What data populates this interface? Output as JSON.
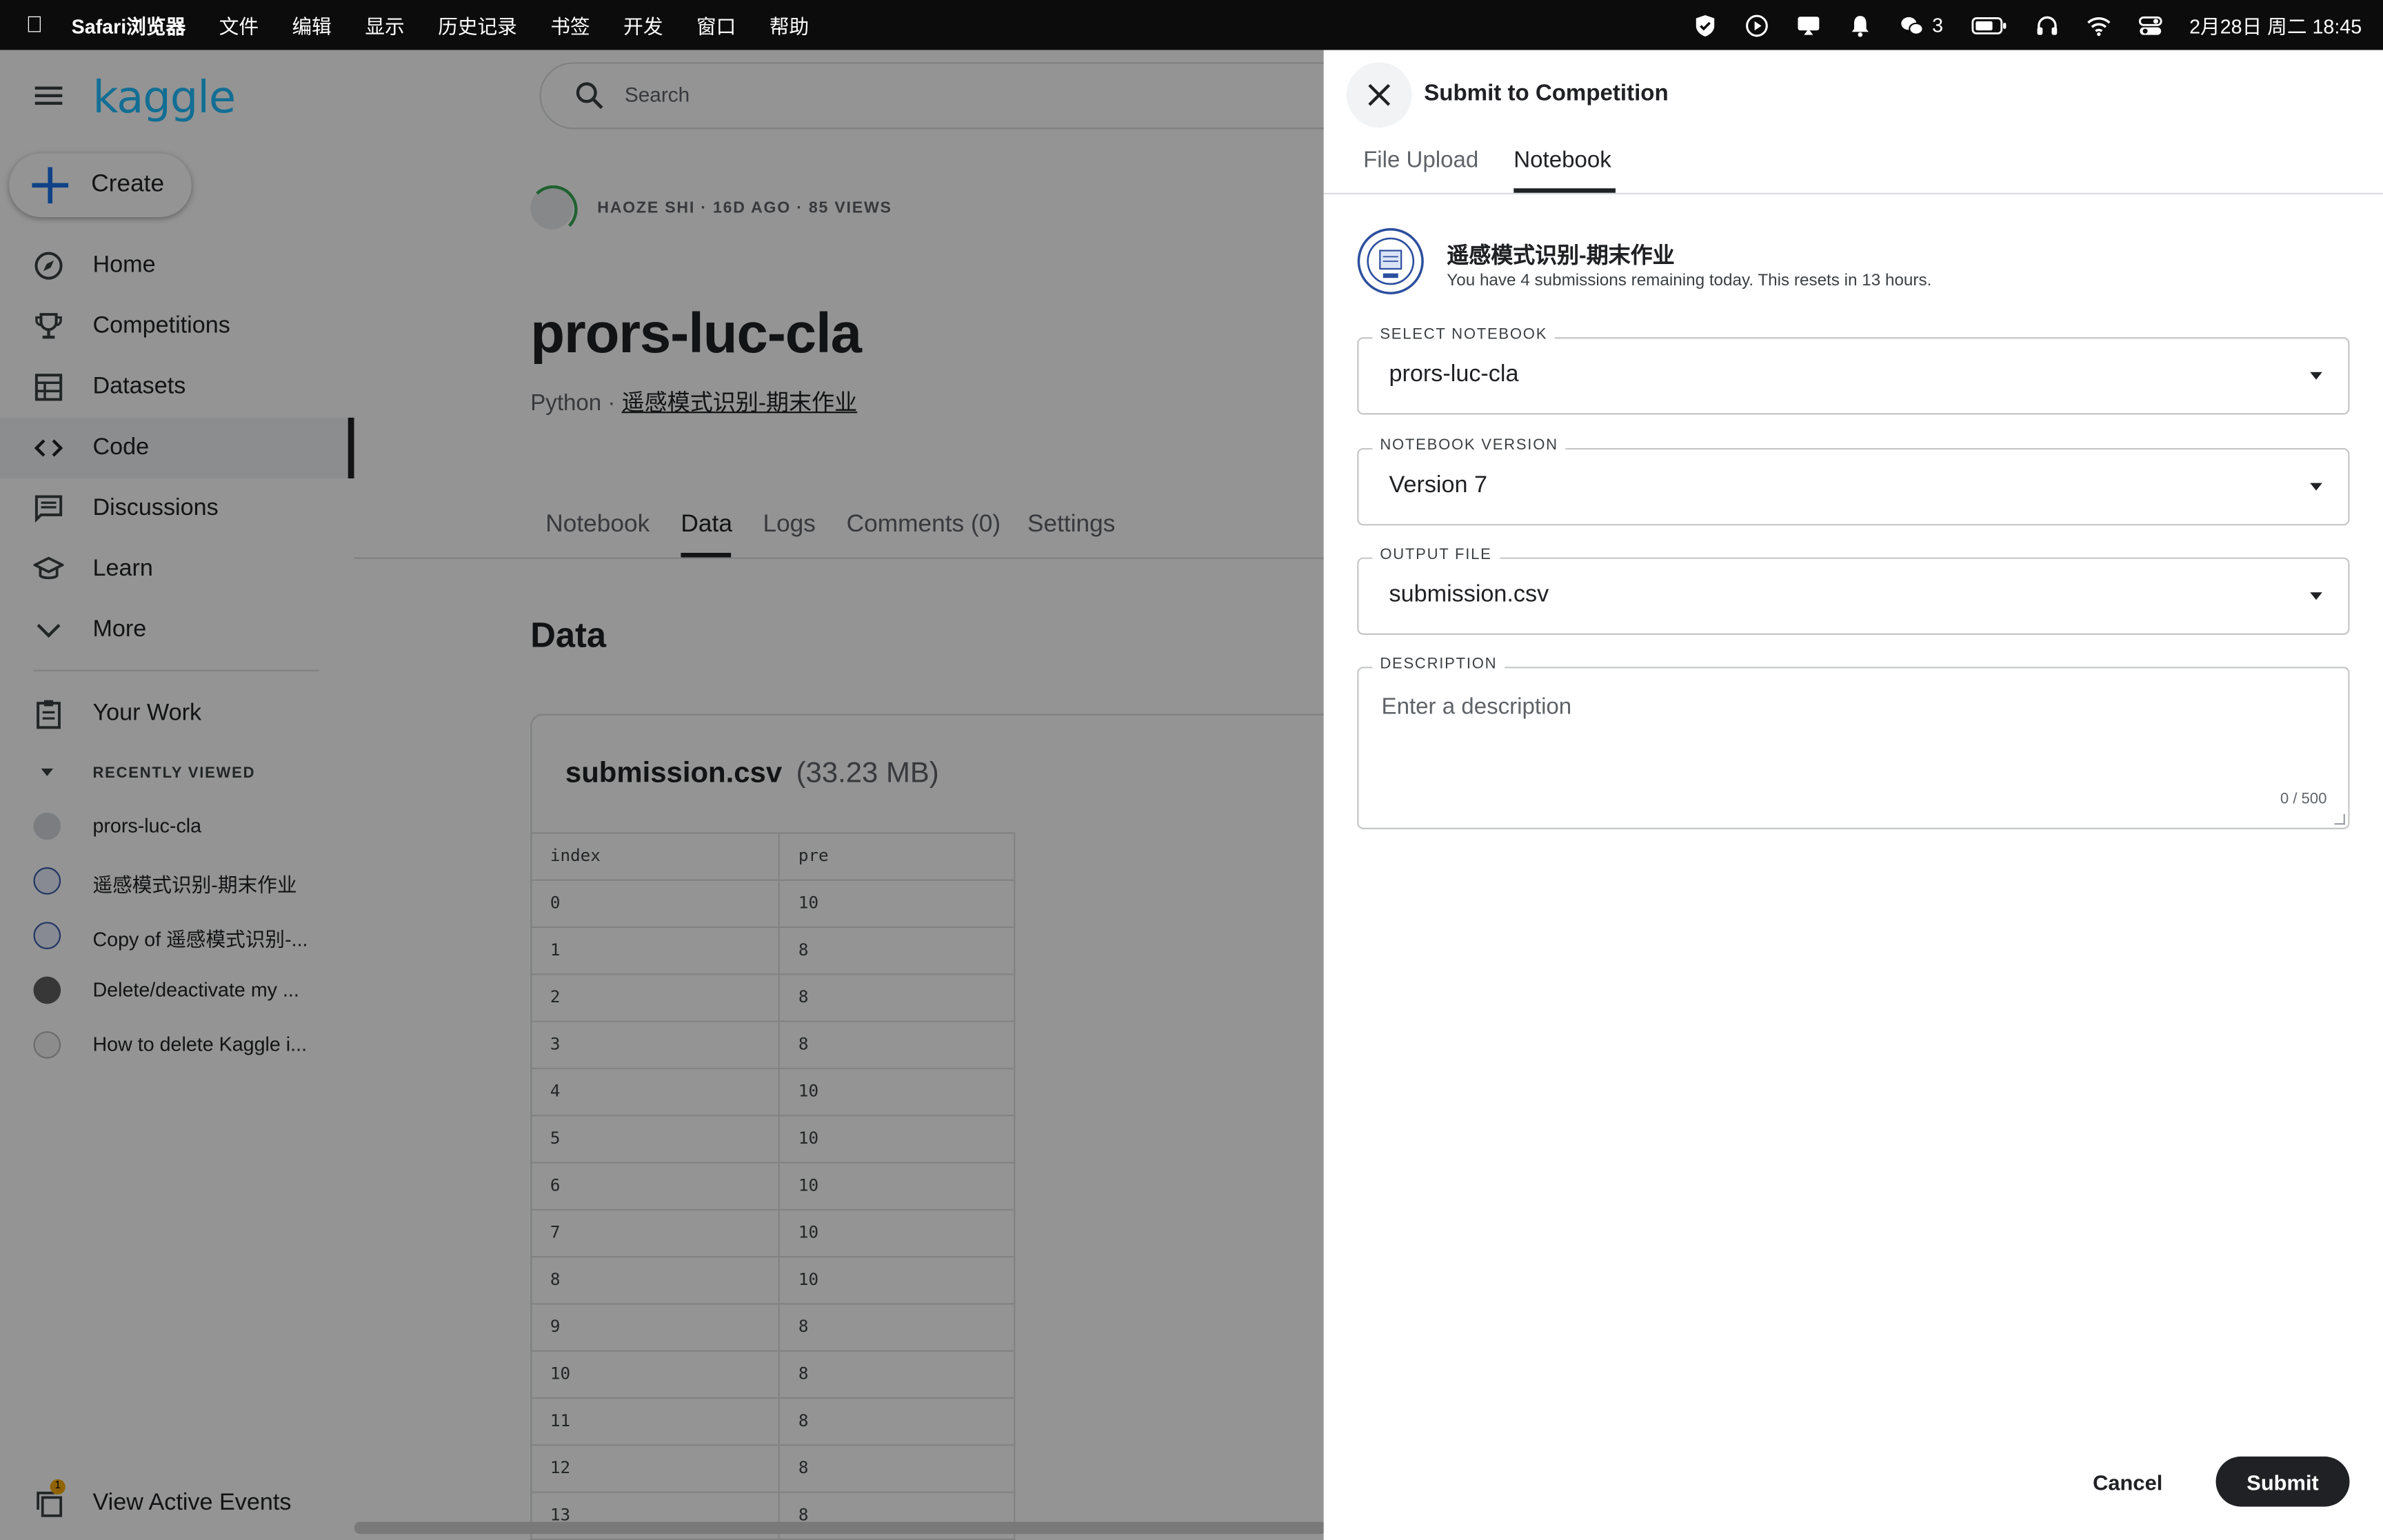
{
  "menubar": {
    "app": "Safari浏览器",
    "menus": [
      "文件",
      "编辑",
      "显示",
      "历史记录",
      "书签",
      "开发",
      "窗口",
      "帮助"
    ],
    "wechat_badge": "3",
    "clock": "2月28日 周二  18:45"
  },
  "sidebar": {
    "logo": "kaggle",
    "create_label": "Create",
    "nav": [
      {
        "label": "Home",
        "icon": "compass-icon"
      },
      {
        "label": "Competitions",
        "icon": "trophy-icon"
      },
      {
        "label": "Datasets",
        "icon": "table-icon"
      },
      {
        "label": "Code",
        "icon": "code-icon",
        "active": true
      },
      {
        "label": "Discussions",
        "icon": "discussion-icon"
      },
      {
        "label": "Learn",
        "icon": "school-icon"
      },
      {
        "label": "More",
        "icon": "chevron-down-icon"
      }
    ],
    "your_work": "Your Work",
    "recently_viewed_header": "RECENTLY VIEWED",
    "recently_viewed": [
      "prors-luc-cla",
      "遥感模式识别-期末作业",
      "Copy of 遥感模式识别-...",
      "Delete/deactivate my ...",
      "How to delete Kaggle i..."
    ],
    "active_events": "View Active Events",
    "active_events_badge": "1"
  },
  "main": {
    "search_placeholder": "Search",
    "author_meta": "HAOZE SHI · 16D AGO · 85 VIEWS",
    "title": "prors-luc-cla",
    "language": "Python · ",
    "competition_link": "遥感模式识别-期末作业",
    "tabs": [
      "Notebook",
      "Data",
      "Logs",
      "Comments (0)",
      "Settings"
    ],
    "active_tab": "Data",
    "data_heading": "Data",
    "file": {
      "name": "submission.csv",
      "size": "(33.23 MB)",
      "columns": [
        "index",
        "pre"
      ],
      "rows": [
        [
          "0",
          "10"
        ],
        [
          "1",
          "8"
        ],
        [
          "2",
          "8"
        ],
        [
          "3",
          "8"
        ],
        [
          "4",
          "10"
        ],
        [
          "5",
          "10"
        ],
        [
          "6",
          "10"
        ],
        [
          "7",
          "10"
        ],
        [
          "8",
          "10"
        ],
        [
          "9",
          "8"
        ],
        [
          "10",
          "8"
        ],
        [
          "11",
          "8"
        ],
        [
          "12",
          "8"
        ],
        [
          "13",
          "8"
        ]
      ]
    }
  },
  "panel": {
    "title": "Submit to Competition",
    "tabs": [
      "File Upload",
      "Notebook"
    ],
    "active_tab": "Notebook",
    "competition_name": "遥感模式识别-期末作业",
    "remaining_note": "You have 4 submissions remaining today. This resets in 13 hours.",
    "select_notebook_label": "SELECT NOTEBOOK",
    "select_notebook_value": "prors-luc-cla",
    "notebook_version_label": "NOTEBOOK VERSION",
    "notebook_version_value": "Version 7",
    "output_file_label": "OUTPUT FILE",
    "output_file_value": "submission.csv",
    "description_label": "DESCRIPTION",
    "description_placeholder": "Enter a description",
    "description_count": "0 / 500",
    "cancel_label": "Cancel",
    "submit_label": "Submit"
  }
}
